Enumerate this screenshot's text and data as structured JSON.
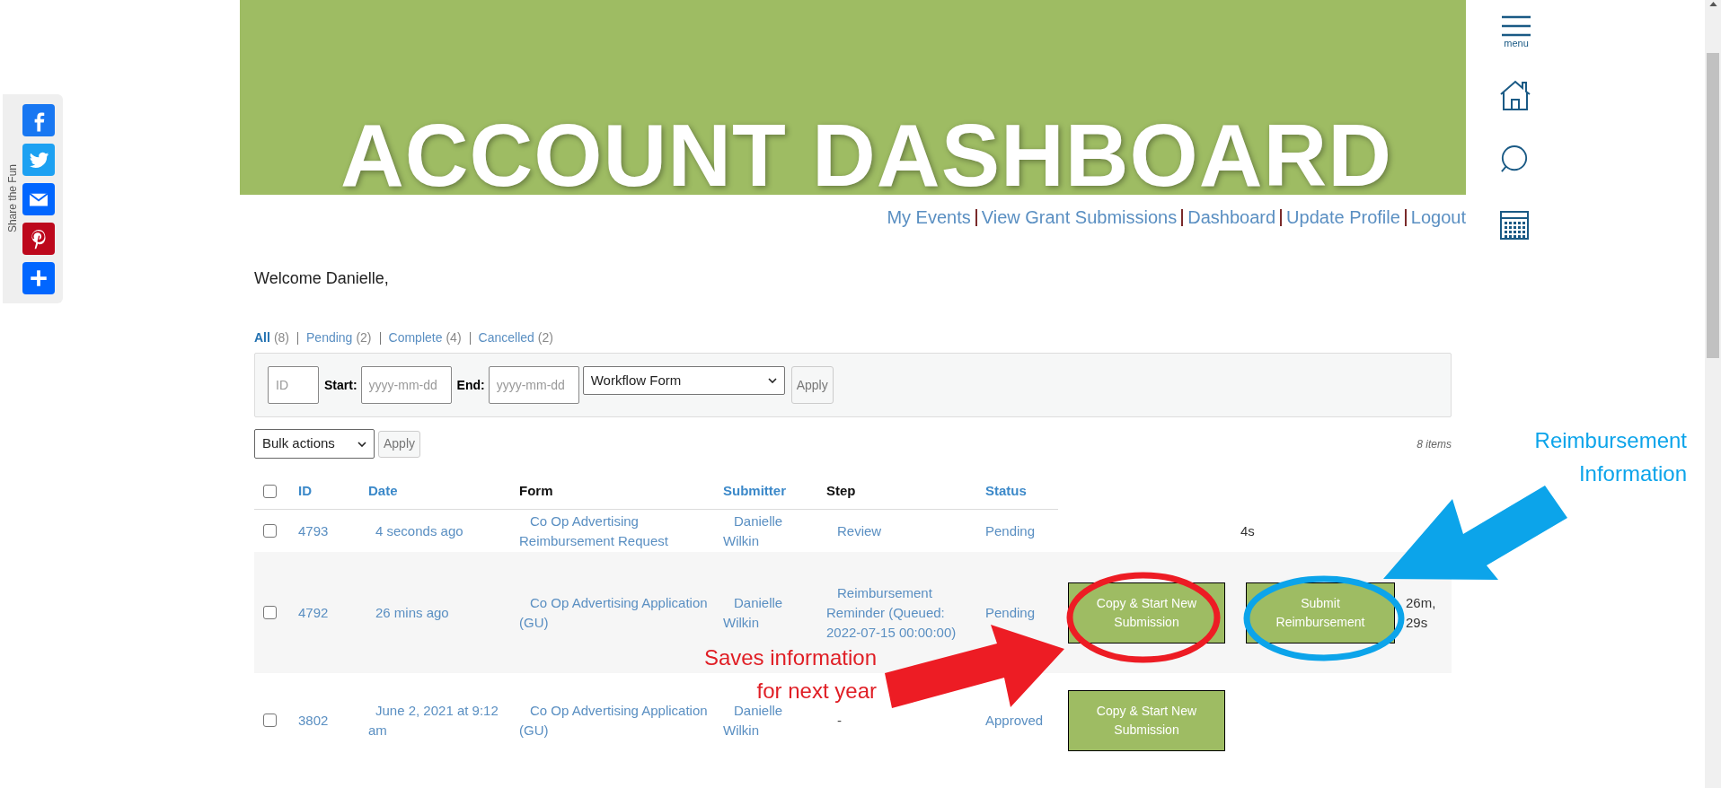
{
  "share_bar": {
    "label": "Share the Fun"
  },
  "banner": {
    "title": "ACCOUNT DASHBOARD"
  },
  "nav": {
    "links": [
      "My Events",
      "View Grant Submissions",
      "Dashboard",
      "Update Profile",
      "Logout"
    ]
  },
  "side_menu": {
    "menu_label": "menu"
  },
  "welcome": "Welcome Danielle,",
  "filters": [
    {
      "label": "All",
      "count": "(8)",
      "selected": true
    },
    {
      "label": "Pending",
      "count": "(2)",
      "selected": false
    },
    {
      "label": "Complete",
      "count": "(4)",
      "selected": false
    },
    {
      "label": "Cancelled",
      "count": "(2)",
      "selected": false
    }
  ],
  "search_panel": {
    "id_placeholder": "ID",
    "start_label": "Start:",
    "start_placeholder": "yyyy-mm-dd",
    "end_label": "End:",
    "end_placeholder": "yyyy-mm-dd",
    "form_select": "Workflow Form",
    "apply": "Apply"
  },
  "bulk": {
    "select": "Bulk actions",
    "apply": "Apply",
    "item_count": "8 items"
  },
  "table": {
    "header_checked": false,
    "columns": [
      {
        "label": "ID",
        "sortable": true
      },
      {
        "label": "Date",
        "sortable": true
      },
      {
        "label": "Form",
        "sortable": false
      },
      {
        "label": "Submitter",
        "sortable": true
      },
      {
        "label": "Step",
        "sortable": false
      },
      {
        "label": "Status",
        "sortable": true
      }
    ],
    "rows": [
      {
        "checked": false,
        "id": "4793",
        "date": "4 seconds ago",
        "form": "Co Op Advertising Reimbursement Request",
        "submitter": "Danielle Wilkin",
        "step": "Review",
        "status": "Pending",
        "actions": [],
        "time": "4s"
      },
      {
        "checked": false,
        "id": "4792",
        "date": "26 mins ago",
        "form": "Co Op Advertising Application (GU)",
        "submitter": "Danielle Wilkin",
        "step": "Reimbursement Reminder (Queued: 2022-07-15 00:00:00)",
        "status": "Pending",
        "actions": [
          "Copy & Start New Submission",
          "Submit Reimbursement"
        ],
        "time": "26m, 29s"
      },
      {
        "checked": false,
        "id": "3802",
        "date": "June 2, 2021 at 9:12 am",
        "form": "Co Op Advertising Application (GU)",
        "submitter": "Danielle Wilkin",
        "step": "-",
        "status": "Approved",
        "actions": [
          "Copy & Start New Submission"
        ]
      }
    ]
  },
  "annotations": {
    "red_note": [
      "Saves information",
      "for next year"
    ],
    "blue_note": [
      "Reimbursement",
      "Information"
    ]
  }
}
